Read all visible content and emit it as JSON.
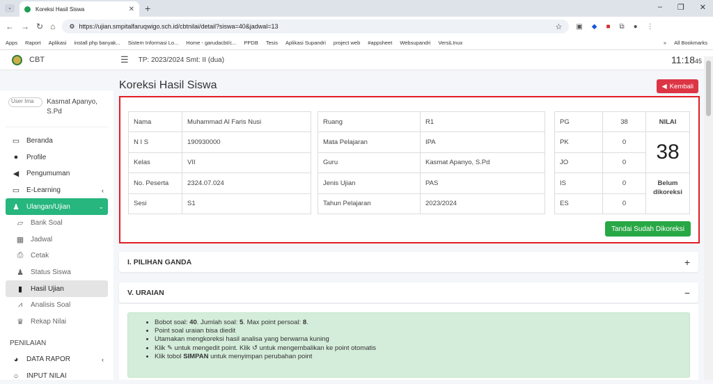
{
  "browser": {
    "tab_title": "Koreksi Hasil Siswa",
    "url": "https://ujian.smpitalfaruqwigo.sch.id/cbtnilai/detail?siswa=40&jadwal=13",
    "bookmarks": [
      "Apps",
      "Raport",
      "Aplikasi",
      "install php banyak...",
      "Sistem Informasi Lo...",
      "Home - garudacbt/c...",
      "PPDB",
      "Tesis",
      "Aplikasi Supandri",
      "project web",
      "#appsheet",
      "Websupandri",
      "VersiLInux"
    ],
    "all_bookmarks": "All Bookmarks"
  },
  "app": {
    "brand": "CBT",
    "tp": "TP: 2023/2024 Smt: II (dua)",
    "clock": "11:18",
    "clock_sec": "45"
  },
  "user": {
    "img_alt": "User Ima",
    "name": "Kasmat Apanyo, S.Pd"
  },
  "nav": {
    "beranda": "Beranda",
    "profile": "Profile",
    "pengumuman": "Pengumuman",
    "elearning": "E-Learning",
    "ulangan": "Ulangan/Ujian",
    "bank_soal": "Bank Soal",
    "jadwal": "Jadwal",
    "cetak": "Cetak",
    "status_siswa": "Status Siswa",
    "hasil_ujian": "Hasil Ujian",
    "analisis_soal": "Analisis Soal",
    "rekap_nilai": "Rekap Nilai",
    "penilaian": "PENILAIAN",
    "data_rapor": "DATA RAPOR",
    "input_nilai": "INPUT NILAI"
  },
  "page": {
    "title": "Koreksi Hasil Siswa",
    "back": "Kembali",
    "mark_done": "Tandai Sudah Dikoreksi"
  },
  "siswa": [
    [
      "Nama",
      "Muhammad Al Faris Nusi"
    ],
    [
      "N I S",
      "190930000"
    ],
    [
      "Kelas",
      "VII"
    ],
    [
      "No. Peserta",
      "2324.07.024"
    ],
    [
      "Sesi",
      "S1"
    ]
  ],
  "ujian": [
    [
      "Ruang",
      "R1"
    ],
    [
      "Mata Pelajaran",
      "IPA"
    ],
    [
      "Guru",
      "Kasmat Apanyo, S.Pd"
    ],
    [
      "Jenis Ujian",
      "PAS"
    ],
    [
      "Tahun Pelajaran",
      "2023/2024"
    ]
  ],
  "skor": [
    [
      "PG",
      "38"
    ],
    [
      "PK",
      "0"
    ],
    [
      "JO",
      "0"
    ],
    [
      "IS",
      "0"
    ],
    [
      "ES",
      "0"
    ]
  ],
  "nilai": {
    "label": "NILAI",
    "value": "38",
    "status": "Belum dikoreksi"
  },
  "sections": {
    "pg": "I. PILIHAN GANDA",
    "uraian": "V. URAIAN"
  },
  "info": {
    "l1a": "Bobot soal: ",
    "l1b": "40",
    "l1c": ". Jumlah soal: ",
    "l1d": "5",
    "l1e": ". Max point persoal: ",
    "l1f": "8",
    "l1g": ".",
    "l2": "Point soal uraian bisa diedit",
    "l3": "Utamakan mengkoreksi hasil analisa yang berwarna kuning",
    "l4a": "Klik ",
    "l4b": " untuk mengedit point. Klik ",
    "l4c": " untuk mengembalikan ke point otomatis",
    "l5a": "Klik tobol ",
    "l5b": "SIMPAN",
    "l5c": " untuk menyimpan perubahan point"
  }
}
